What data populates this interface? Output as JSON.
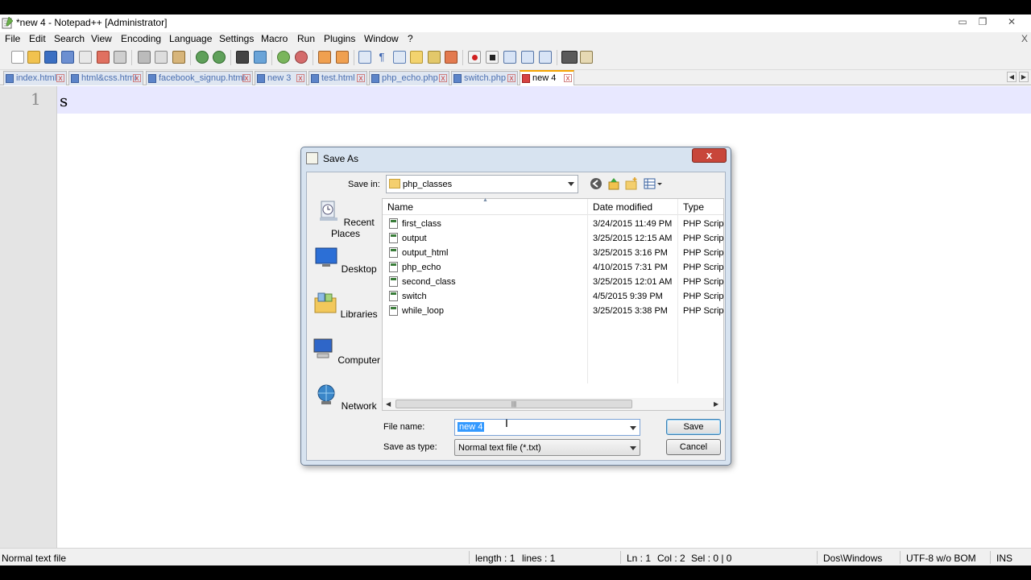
{
  "window": {
    "title": "*new  4 - Notepad++ [Administrator]"
  },
  "window_buttons": {
    "minimize": "▭",
    "restore": "❐",
    "close": "✕"
  },
  "menu": {
    "items": [
      "File",
      "Edit",
      "Search",
      "View",
      "Encoding",
      "Language",
      "Settings",
      "Macro",
      "Run",
      "Plugins",
      "Window",
      "?"
    ],
    "close": "X"
  },
  "tabs": [
    {
      "label": "index.html",
      "active": false
    },
    {
      "label": "html&css.html",
      "active": false
    },
    {
      "label": "facebook_signup.html",
      "active": false
    },
    {
      "label": "new  3",
      "active": false
    },
    {
      "label": "test.html",
      "active": false
    },
    {
      "label": "php_echo.php",
      "active": false
    },
    {
      "label": "switch.php",
      "active": false
    },
    {
      "label": "new  4",
      "active": true
    }
  ],
  "tab_close": "x",
  "editor": {
    "line_number": "1",
    "text": "s"
  },
  "status": {
    "file_type": "Normal text file",
    "length": "length : 1",
    "lines": "lines : 1",
    "ln": "Ln : 1",
    "col": "Col : 2",
    "sel": "Sel : 0 | 0",
    "eol": "Dos\\Windows",
    "encoding": "UTF-8 w/o BOM",
    "mode": "INS"
  },
  "dialog": {
    "title": "Save As",
    "close": "x",
    "save_in_label": "Save in:",
    "save_in_value": "php_classes",
    "places": [
      "Recent Places",
      "Desktop",
      "Libraries",
      "Computer",
      "Network"
    ],
    "columns": {
      "name": "Name",
      "date": "Date modified",
      "type": "Type"
    },
    "files": [
      {
        "name": "first_class",
        "date": "3/24/2015 11:49 PM",
        "type": "PHP Scrip"
      },
      {
        "name": "output",
        "date": "3/25/2015 12:15 AM",
        "type": "PHP Scrip"
      },
      {
        "name": "output_html",
        "date": "3/25/2015 3:16 PM",
        "type": "PHP Scrip"
      },
      {
        "name": "php_echo",
        "date": "4/10/2015 7:31 PM",
        "type": "PHP Scrip"
      },
      {
        "name": "second_class",
        "date": "3/25/2015 12:01 AM",
        "type": "PHP Scrip"
      },
      {
        "name": "switch",
        "date": "4/5/2015 9:39 PM",
        "type": "PHP Scrip"
      },
      {
        "name": "while_loop",
        "date": "3/25/2015 3:38 PM",
        "type": "PHP Scrip"
      }
    ],
    "file_name_label": "File name:",
    "file_name_value": "new  4",
    "save_as_type_label": "Save as type:",
    "save_as_type_value": "Normal text file (*.txt)",
    "save_button": "Save",
    "cancel_button": "Cancel"
  }
}
